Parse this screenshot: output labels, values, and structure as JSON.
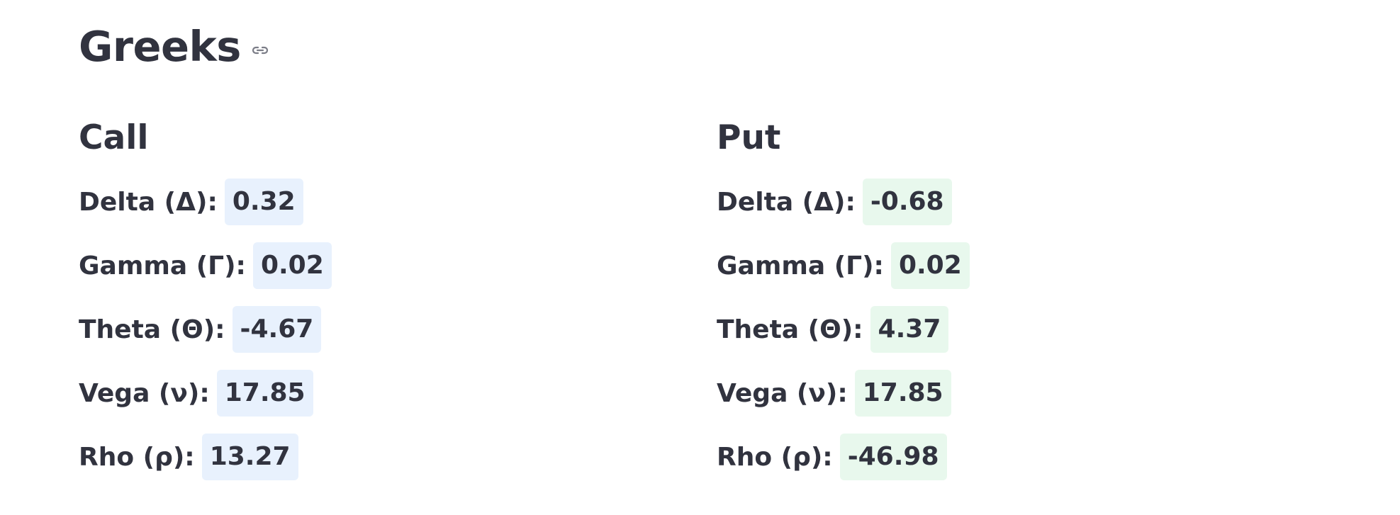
{
  "header": {
    "title": "Greeks",
    "link_icon": "link-icon"
  },
  "colors": {
    "text": "#31333f",
    "call_value_bg": "#e8f1fd",
    "put_value_bg": "#e8f8ed"
  },
  "call": {
    "title": "Call",
    "metrics": [
      {
        "label": "Delta (Δ):",
        "value": "0.32"
      },
      {
        "label": "Gamma (Γ):",
        "value": "0.02"
      },
      {
        "label": "Theta (Θ):",
        "value": "-4.67"
      },
      {
        "label": "Vega (ν):",
        "value": "17.85"
      },
      {
        "label": "Rho (ρ):",
        "value": "13.27"
      }
    ]
  },
  "put": {
    "title": "Put",
    "metrics": [
      {
        "label": "Delta (Δ):",
        "value": "-0.68"
      },
      {
        "label": "Gamma (Γ):",
        "value": "0.02"
      },
      {
        "label": "Theta (Θ):",
        "value": "4.37"
      },
      {
        "label": "Vega (ν):",
        "value": "17.85"
      },
      {
        "label": "Rho (ρ):",
        "value": "-46.98"
      }
    ]
  }
}
